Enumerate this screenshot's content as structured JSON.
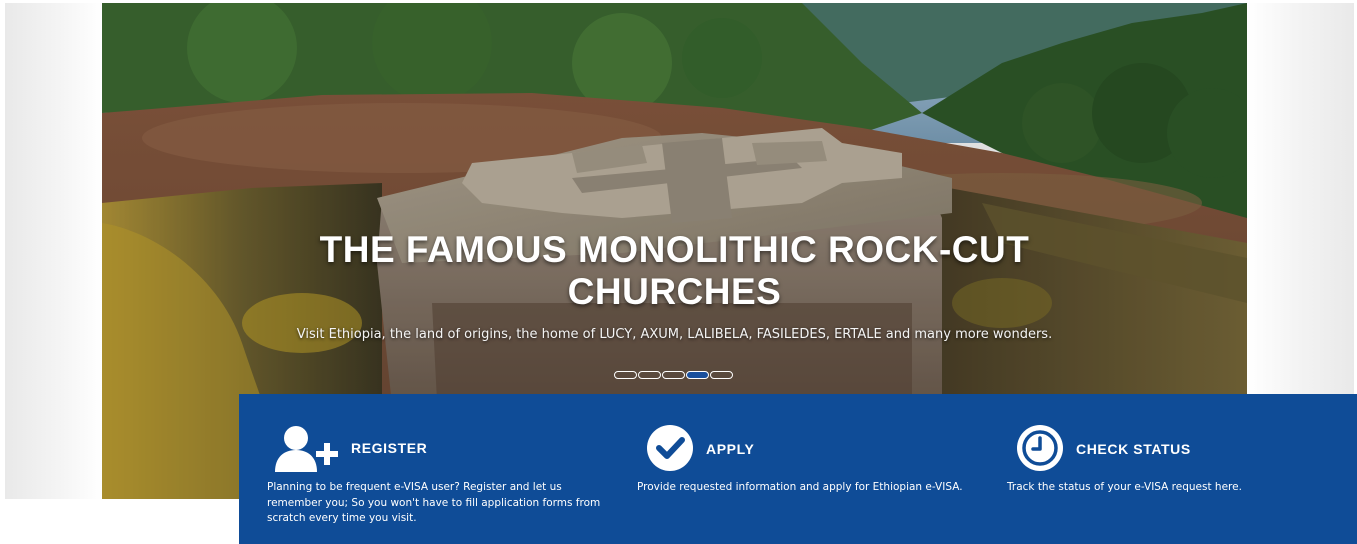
{
  "hero": {
    "title_line1": "THE FAMOUS MONOLITHIC ROCK-CUT",
    "title_line2": "CHURCHES",
    "subtitle": "Visit Ethiopia, the land of origins, the home of LUCY, AXUM, LALIBELA, FASILEDES, ERTALE and many more wonders.",
    "slides_total": 5,
    "active_slide": 4
  },
  "services": [
    {
      "id": "register",
      "icon": "user-add-icon",
      "title": "REGISTER",
      "description": "Planning to be frequent e-VISA user? Register and let us remember you; So you won't have to fill application forms from scratch every time you visit."
    },
    {
      "id": "apply",
      "icon": "check-circle-icon",
      "title": "APPLY",
      "description": "Provide requested information and apply for Ethiopian e-VISA."
    },
    {
      "id": "check-status",
      "icon": "clock-icon",
      "title": "CHECK STATUS",
      "description": "Track the status of your e-VISA request here."
    }
  ],
  "colors": {
    "panel": "#0f4c97",
    "active_dot": "#1a4f9c"
  }
}
